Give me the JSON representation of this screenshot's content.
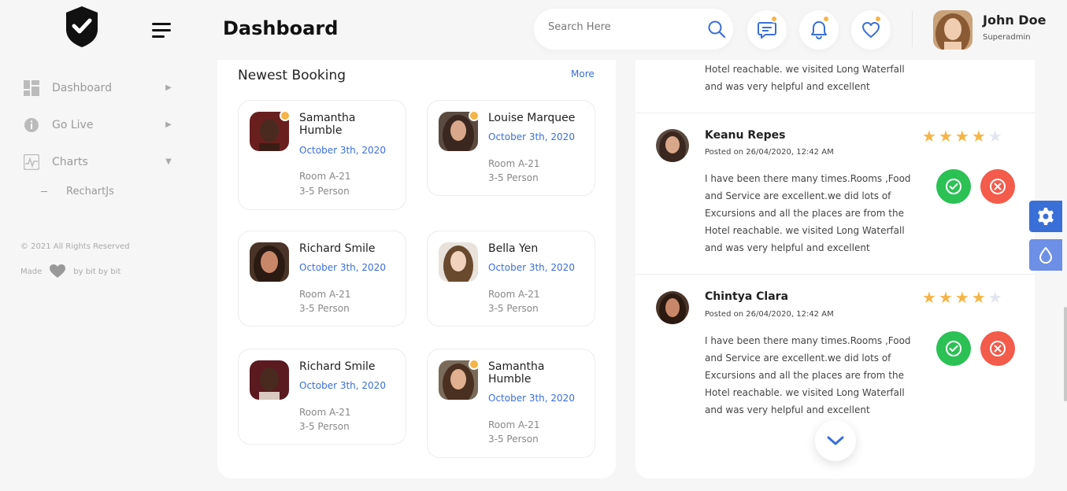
{
  "header": {
    "title": "Dashboard",
    "search_placeholder": "Search Here",
    "user": {
      "name": "John Doe",
      "role": "Superadmin"
    }
  },
  "sidebar": {
    "items": [
      {
        "label": "Dashboard",
        "icon": "grid-icon",
        "arrow": "right"
      },
      {
        "label": "Go Live",
        "icon": "info-icon",
        "arrow": "right"
      },
      {
        "label": "Charts",
        "icon": "chart-icon",
        "arrow": "down"
      }
    ],
    "sub_items": [
      {
        "label": "RechartJs"
      }
    ],
    "footer": {
      "copyright": "© 2021 All Rights Reserved",
      "made_prefix": "Made",
      "made_suffix": "by bit by bit"
    }
  },
  "booking": {
    "title": "Newest Booking",
    "more": "More",
    "cards": [
      {
        "name": "Samantha Humble",
        "date": "October 3th, 2020",
        "room": "Room A-21",
        "persons": "3-5 Person",
        "online": true
      },
      {
        "name": "Louise Marquee",
        "date": "October 3th, 2020",
        "room": "Room A-21",
        "persons": "3-5 Person",
        "online": true
      },
      {
        "name": "Richard Smile",
        "date": "October 3th, 2020",
        "room": "Room A-21",
        "persons": "3-5 Person",
        "online": false
      },
      {
        "name": "Bella Yen",
        "date": "October 3th, 2020",
        "room": "Room A-21",
        "persons": "3-5 Person",
        "online": false
      },
      {
        "name": "Richard Smile",
        "date": "October 3th, 2020",
        "room": "Room A-21",
        "persons": "3-5 Person",
        "online": false
      },
      {
        "name": "Samantha Humble",
        "date": "October 3th, 2020",
        "room": "Room A-21",
        "persons": "3-5 Person",
        "online": true
      }
    ]
  },
  "reviews": {
    "partial_text_line1": "Hotel reachable. we visited Long Waterfall",
    "partial_text_line2": "and was very helpful and excellent",
    "items": [
      {
        "name": "Keanu Repes",
        "posted": "Posted on 26/04/2020, 12:42 AM",
        "rating": 4,
        "lines": [
          "I have been there many times.Rooms ,Food",
          "and Service are excellent.we did lots of",
          "Excursions and all the places are from the",
          "Hotel reachable. we visited Long Waterfall",
          "and was very helpful and excellent"
        ]
      },
      {
        "name": "Chintya Clara",
        "posted": "Posted on 26/04/2020, 12:42 AM",
        "rating": 4,
        "lines": [
          "I have been there many times.Rooms ,Food",
          "and Service are excellent.we did lots of",
          "Excursions and all the places are from the",
          "Hotel reachable. we visited Long Waterfall",
          "and was very helpful and excellent"
        ]
      }
    ]
  },
  "colors": {
    "accent": "#3a6fd8",
    "online_dot": "#f6b446",
    "star_active": "#f6b446",
    "star_inactive": "#e3e6f0",
    "approve": "#2bc155",
    "reject": "#f35b4b"
  }
}
